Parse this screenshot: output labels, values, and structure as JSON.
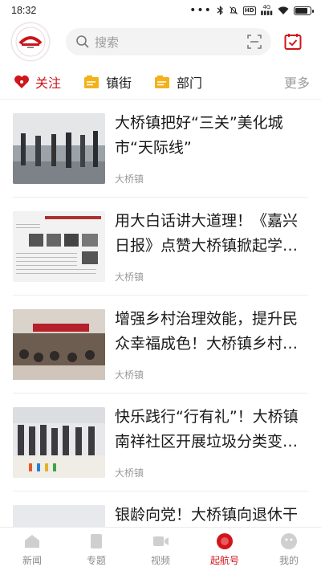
{
  "status": {
    "time": "18:32",
    "network": "4G",
    "hd": "HD"
  },
  "header": {
    "search_placeholder": "搜索"
  },
  "channels": [
    {
      "label": "关注",
      "icon": "heart-icon",
      "active": true
    },
    {
      "label": "镇街",
      "icon": "folder-icon",
      "active": false
    },
    {
      "label": "部门",
      "icon": "folder-icon",
      "active": false
    }
  ],
  "channels_more": "更多",
  "feed": [
    {
      "title": "大桥镇把好“三关”美化城市“天际线”",
      "source": "大桥镇"
    },
    {
      "title": "用大白话讲大道理！《嘉兴日报》点赞大桥镇掀起学习宣…",
      "source": "大桥镇"
    },
    {
      "title": "增强乡村治理效能，提升民众幸福成色！大桥镇乡村治理…",
      "source": "大桥镇"
    },
    {
      "title": "快乐践行“行有礼”！大桥镇南祥社区开展垃圾分类变废为…",
      "source": "大桥镇"
    },
    {
      "title": "银龄向党！大桥镇向退休干部",
      "source": ""
    }
  ],
  "tabs": [
    {
      "label": "新闻",
      "icon": "home-icon"
    },
    {
      "label": "专题",
      "icon": "topic-icon"
    },
    {
      "label": "视频",
      "icon": "video-icon"
    },
    {
      "label": "起航号",
      "icon": "sail-icon",
      "active": true
    },
    {
      "label": "我的",
      "icon": "profile-icon"
    }
  ],
  "colors": {
    "accent": "#d0151b",
    "muted": "#9a9a9a"
  }
}
